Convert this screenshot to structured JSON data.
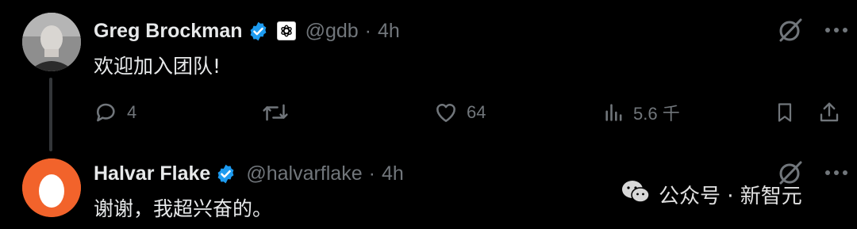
{
  "tweet": {
    "author_name": "Greg Brockman",
    "handle": "@gdb",
    "separator": "·",
    "time": "4h",
    "text": "欢迎加入团队!",
    "actions": {
      "replies": "4",
      "likes": "64",
      "views": "5.6 千"
    },
    "icons": [
      "verified-badge-icon",
      "openai-affiliation-icon",
      "grok-icon",
      "more-icon",
      "reply-icon",
      "retweet-icon",
      "like-icon",
      "views-icon",
      "bookmark-icon",
      "share-icon"
    ]
  },
  "reply": {
    "author_name": "Halvar Flake",
    "handle": "@halvarflake",
    "separator": "·",
    "time": "4h",
    "text": "谢谢，我超兴奋的。"
  },
  "watermark": {
    "text": "公众号 · 新智元"
  },
  "colors": {
    "background": "#000000",
    "text": "#e7e9ea",
    "muted": "#71767b",
    "verified": "#1d9bf0",
    "reply_avatar": "#f2632b"
  }
}
